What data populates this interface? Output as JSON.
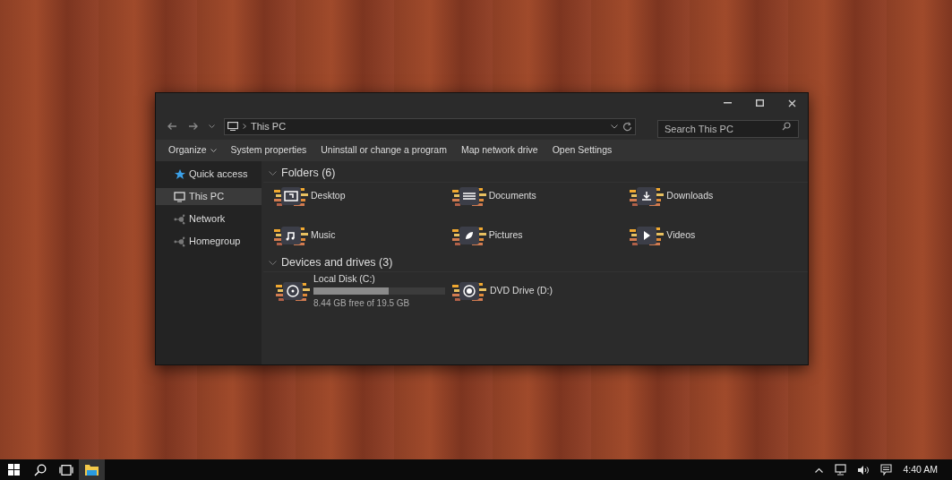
{
  "window": {
    "address": {
      "location": "This PC"
    },
    "search": {
      "placeholder": "Search This PC"
    }
  },
  "commands": [
    {
      "label": "Organize",
      "dropdown": true
    },
    {
      "label": "System properties",
      "dropdown": false
    },
    {
      "label": "Uninstall or change a program",
      "dropdown": false
    },
    {
      "label": "Map network drive",
      "dropdown": false
    },
    {
      "label": "Open Settings",
      "dropdown": false
    }
  ],
  "sidebar": {
    "items": [
      {
        "label": "Quick access",
        "kind": "star",
        "selected": false
      },
      {
        "label": "This PC",
        "kind": "pc",
        "selected": true
      },
      {
        "label": "Network",
        "kind": "network",
        "selected": false
      },
      {
        "label": "Homegroup",
        "kind": "network",
        "selected": false
      }
    ]
  },
  "folders": {
    "title": "Folders (6)",
    "expanded": true,
    "items": [
      {
        "label": "Desktop",
        "kind": "desktop"
      },
      {
        "label": "Documents",
        "kind": "documents"
      },
      {
        "label": "Downloads",
        "kind": "downloads"
      },
      {
        "label": "Music",
        "kind": "music"
      },
      {
        "label": "Pictures",
        "kind": "pictures"
      },
      {
        "label": "Videos",
        "kind": "videos"
      }
    ]
  },
  "drives": {
    "title": "Devices and drives (3)",
    "expanded": true,
    "items": [
      {
        "label": "Local Disk (C:)",
        "kind": "disk",
        "level": 0.57,
        "free": "8.44 GB free of 19.5 GB"
      },
      {
        "label": "DVD Drive (D:)",
        "kind": "dvd"
      }
    ]
  },
  "taskbar": {
    "apps": [
      {
        "kind": "start",
        "selected": false
      },
      {
        "kind": "search",
        "selected": false
      },
      {
        "kind": "taskview",
        "selected": false
      },
      {
        "kind": "explorer",
        "selected": true
      }
    ],
    "clock": "4:40 AM"
  }
}
